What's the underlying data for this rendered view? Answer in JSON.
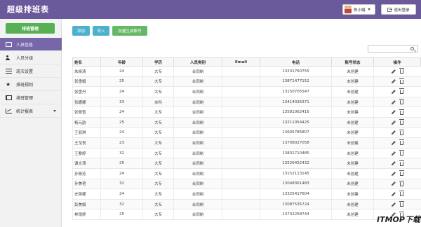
{
  "header": {
    "title": "超级排班表",
    "user_name": "陈小娟",
    "logout_label": "退出登录",
    "bar_color": "#6a5a9c"
  },
  "sidebar": {
    "primary_button": "排班管理",
    "items": [
      {
        "label": "人员信息",
        "icon": "id-card-icon",
        "active": true
      },
      {
        "label": "人员分组",
        "icon": "users-icon"
      },
      {
        "label": "班次设置",
        "icon": "list-icon"
      },
      {
        "label": "排班规则",
        "icon": "star-icon"
      },
      {
        "label": "排班管理",
        "icon": "book-icon"
      },
      {
        "label": "统计报表",
        "icon": "chart-icon",
        "has_submenu": true
      }
    ]
  },
  "toolbar": {
    "add_label": "添加",
    "import_label": "导入",
    "batch_label": "批量生成账号"
  },
  "table": {
    "columns": [
      "姓名",
      "年龄",
      "学历",
      "人员类别",
      "Email",
      "电话",
      "账号状态",
      "操作"
    ],
    "rows": [
      [
        "朱晓清",
        "24",
        "大专",
        "合同制",
        "",
        "13231760755",
        "未创建"
      ],
      [
        "张雪娟",
        "25",
        "大专",
        "合同制",
        "",
        "13871477152",
        "未创建"
      ],
      [
        "张雪丹",
        "24",
        "大专",
        "合同制",
        "",
        "13150705547",
        "未创建"
      ],
      [
        "张娜娜",
        "33",
        "本科",
        "合同制",
        "",
        "13414026371",
        "未创建"
      ],
      [
        "张佩雪",
        "24",
        "大专",
        "合同制",
        "",
        "13581062416",
        "未创建"
      ],
      [
        "杨元韵",
        "25",
        "大专",
        "合同制",
        "",
        "13211054425",
        "未创建"
      ],
      [
        "王丽琪",
        "24",
        "大专",
        "合同制",
        "",
        "13605785807",
        "未创建"
      ],
      [
        "王戈悦",
        "23",
        "大专",
        "合同制",
        "",
        "13708027058",
        "未创建"
      ],
      [
        "王紫婷",
        "32",
        "大专",
        "合同制",
        "",
        "13831710485",
        "未创建"
      ],
      [
        "谭文涛",
        "25",
        "大专",
        "合同制",
        "",
        "13526452432",
        "未创建"
      ],
      [
        "孙佩芳",
        "24",
        "大专",
        "合同制",
        "",
        "13152113145",
        "未创建"
      ],
      [
        "孙美艳",
        "32",
        "大专",
        "合同制",
        "",
        "13048361483",
        "未创建"
      ],
      [
        "史英娜",
        "24",
        "大专",
        "合同制",
        "",
        "13325417604",
        "未创建"
      ],
      [
        "彭美娟",
        "32",
        "大专",
        "合同制",
        "",
        "13087535724",
        "未创建"
      ],
      [
        "林雨婷",
        "25",
        "大专",
        "合同制",
        "",
        "13742258744",
        "未创建"
      ]
    ]
  },
  "watermark": "ITMOP下载网"
}
